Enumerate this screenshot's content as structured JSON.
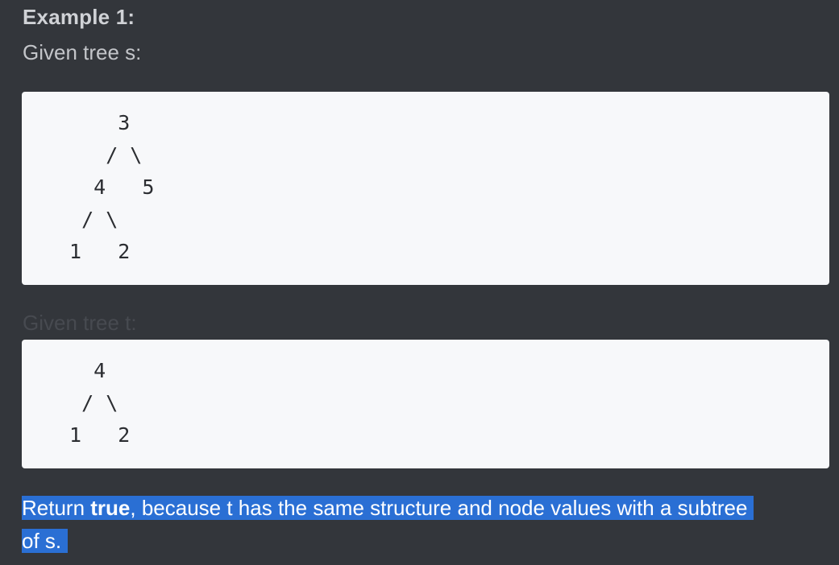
{
  "example": {
    "heading": "Example 1:",
    "tree_s_label": "Given tree s:",
    "tree_s_code": "     3\n    / \\\n   4   5\n  / \\\n 1   2",
    "tree_t_label": "Given tree t:",
    "tree_t_code": "   4\n  / \\\n 1   2",
    "result_prefix": "Return ",
    "result_bold": "true",
    "result_suffix": ", because t has the same structure and node values with a subtree of s."
  },
  "colors": {
    "background": "#33363b",
    "code_background": "#f7f8fa",
    "selection_highlight": "#2a6fd4"
  }
}
